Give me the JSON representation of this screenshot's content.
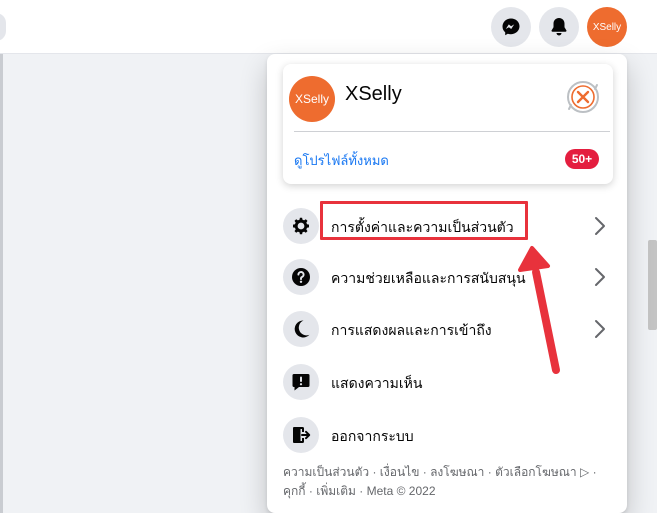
{
  "topbar": {
    "avatar_text": "XSelly",
    "icons": [
      "messenger-icon",
      "bell-icon"
    ]
  },
  "profile": {
    "avatar_text": "XSelly",
    "name": "XSelly",
    "see_all": "ดูโปรไฟล์ทั้งหมด",
    "badge": "50+"
  },
  "menu": {
    "items": [
      {
        "label": "การตั้งค่าและความเป็นส่วนตัว",
        "icon": "gear-icon",
        "has_chevron": true
      },
      {
        "label": "ความช่วยเหลือและการสนับสนุน",
        "icon": "question-icon",
        "has_chevron": true
      },
      {
        "label": "การแสดงผลและการเข้าถึง",
        "icon": "moon-icon",
        "has_chevron": true
      },
      {
        "label": "แสดงความเห็น",
        "icon": "feedback-icon",
        "has_chevron": false
      },
      {
        "label": "ออกจากระบบ",
        "icon": "logout-icon",
        "has_chevron": false
      }
    ]
  },
  "footer": {
    "line1": "ความเป็นส่วนตัว · เงื่อนไข · ลงโฆษณา · ตัวเลือกโฆษณา ▷ ·",
    "line2": "คุกกี้ · เพิ่มเติม · Meta © 2022"
  },
  "colors": {
    "accent": "#1877f2",
    "brand_avatar": "#ee6c2f",
    "badge": "#e41e3f",
    "annotation": "#e8323c"
  }
}
